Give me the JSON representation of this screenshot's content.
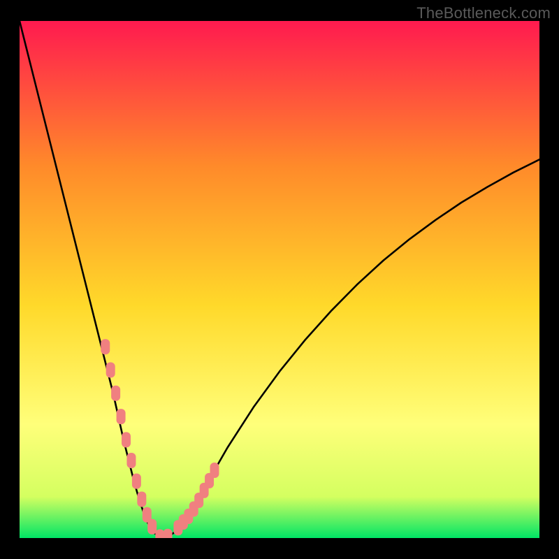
{
  "watermark": "TheBottleneck.com",
  "chart_data": {
    "type": "line",
    "title": "",
    "xlabel": "",
    "ylabel": "",
    "xlim": [
      0,
      100
    ],
    "ylim": [
      0,
      100
    ],
    "curve": {
      "name": "bottleneck-curve",
      "x": [
        0,
        2,
        4,
        6,
        8,
        10,
        12,
        14,
        16,
        18,
        19,
        20,
        21,
        22,
        23,
        24,
        25,
        26,
        27,
        28,
        30,
        32,
        34,
        36,
        38,
        40,
        45,
        50,
        55,
        60,
        65,
        70,
        75,
        80,
        85,
        90,
        95,
        100
      ],
      "y": [
        100,
        92,
        84,
        76,
        68,
        60,
        52,
        44,
        36,
        28,
        23.5,
        19,
        15,
        11,
        7.5,
        4.5,
        2.2,
        0.9,
        0.2,
        0.0,
        1.2,
        3.6,
        6.8,
        10.4,
        14.0,
        17.5,
        25.3,
        32.2,
        38.4,
        44.0,
        49.1,
        53.7,
        57.8,
        61.5,
        64.9,
        67.9,
        70.7,
        73.2
      ]
    },
    "markers": {
      "name": "curve-markers",
      "color": "#f08080",
      "x": [
        16.5,
        17.5,
        18.5,
        19.5,
        20.5,
        21.5,
        22.5,
        23.5,
        24.5,
        25.5,
        27.0,
        28.5,
        30.5,
        31.5,
        32.5,
        33.5,
        34.5,
        35.5,
        36.5,
        37.5
      ],
      "y": [
        37,
        32.5,
        28,
        23.5,
        19,
        15,
        11,
        7.5,
        4.5,
        2.2,
        0.2,
        0.3,
        2.0,
        3.1,
        4.2,
        5.6,
        7.3,
        9.2,
        11.1,
        13.1
      ]
    },
    "background_gradient": {
      "top": "#ff1a4f",
      "mid1": "#ff8a2a",
      "mid2": "#ffd92a",
      "mid3": "#ffff7a",
      "mid4": "#d4ff60",
      "bottom": "#00e565"
    }
  }
}
